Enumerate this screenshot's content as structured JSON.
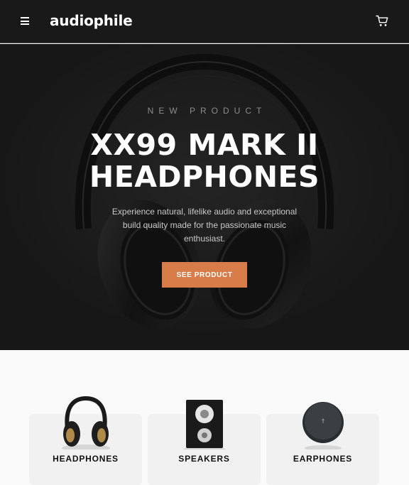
{
  "header": {
    "logo": "audiophile",
    "menu_icon": "hamburger-menu-icon",
    "cart_icon": "cart-icon"
  },
  "hero": {
    "eyebrow": "NEW PRODUCT",
    "title_line1": "XX99 MARK II",
    "title_line2": "HEADPHONES",
    "description": "Experience natural, lifelike audio and exceptional build quality made for the passionate music enthusiast.",
    "cta_label": "SEE PRODUCT"
  },
  "categories": [
    {
      "label": "HEADPHONES",
      "icon": "headphones-image"
    },
    {
      "label": "SPEAKERS",
      "icon": "speaker-image"
    },
    {
      "label": "EARPHONES",
      "icon": "earphones-image"
    }
  ],
  "colors": {
    "accent": "#d87d4a",
    "dark": "#191919",
    "light_bg": "#fafafa",
    "card_bg": "#f1f1f1"
  }
}
